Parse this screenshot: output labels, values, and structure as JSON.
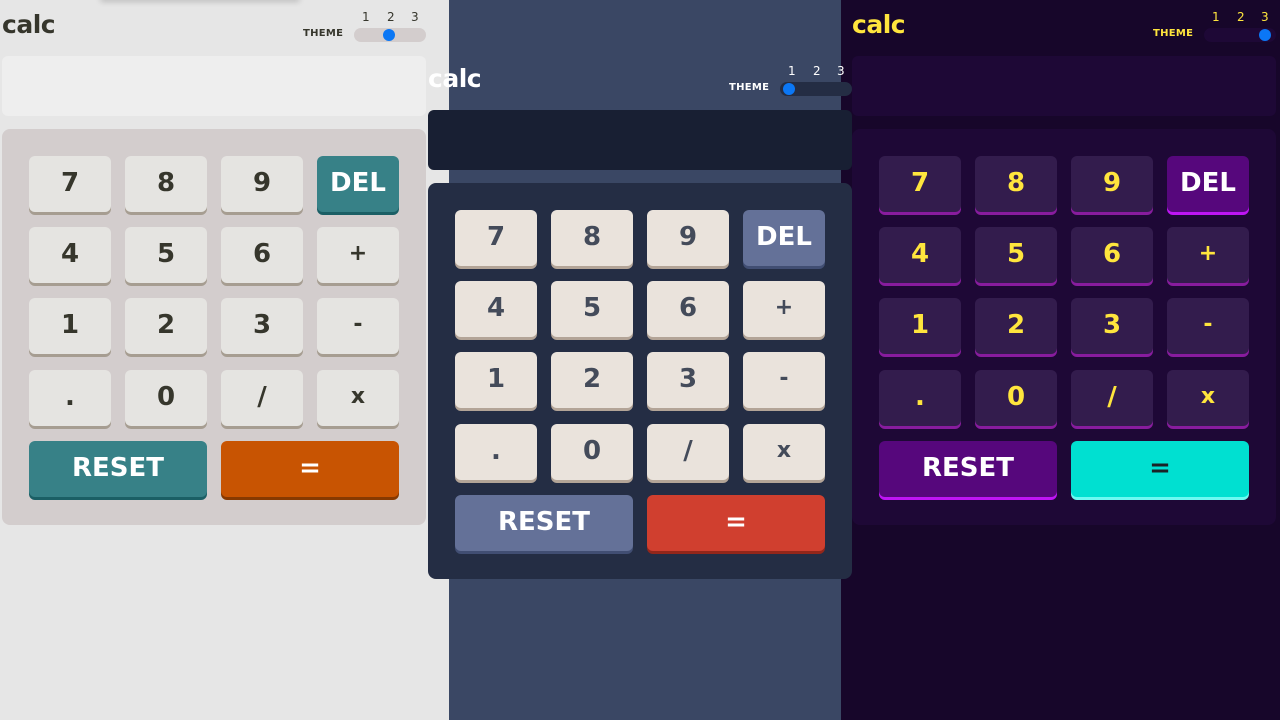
{
  "logo": "calc",
  "theme_label": "THEME",
  "theme_numbers": [
    "1",
    "2",
    "3"
  ],
  "keys": {
    "k7": "7",
    "k8": "8",
    "k9": "9",
    "del": "DEL",
    "k4": "4",
    "k5": "5",
    "k6": "6",
    "plus": "+",
    "k1": "1",
    "k2": "2",
    "k3": "3",
    "minus": "-",
    "dot": ".",
    "k0": "0",
    "divide": "/",
    "times": "x",
    "reset": "RESET",
    "equals": "="
  },
  "themes": [
    {
      "id": "light",
      "selected_theme": 2,
      "display_value": ""
    },
    {
      "id": "mid",
      "selected_theme": 1,
      "display_value": ""
    },
    {
      "id": "dark",
      "selected_theme": 3,
      "display_value": ""
    }
  ],
  "colors": {
    "light_bg": "#e6e6e6",
    "mid_bg": "#3a4764",
    "dark_bg": "#17062a",
    "toggle_knob": "#0b77f5"
  }
}
